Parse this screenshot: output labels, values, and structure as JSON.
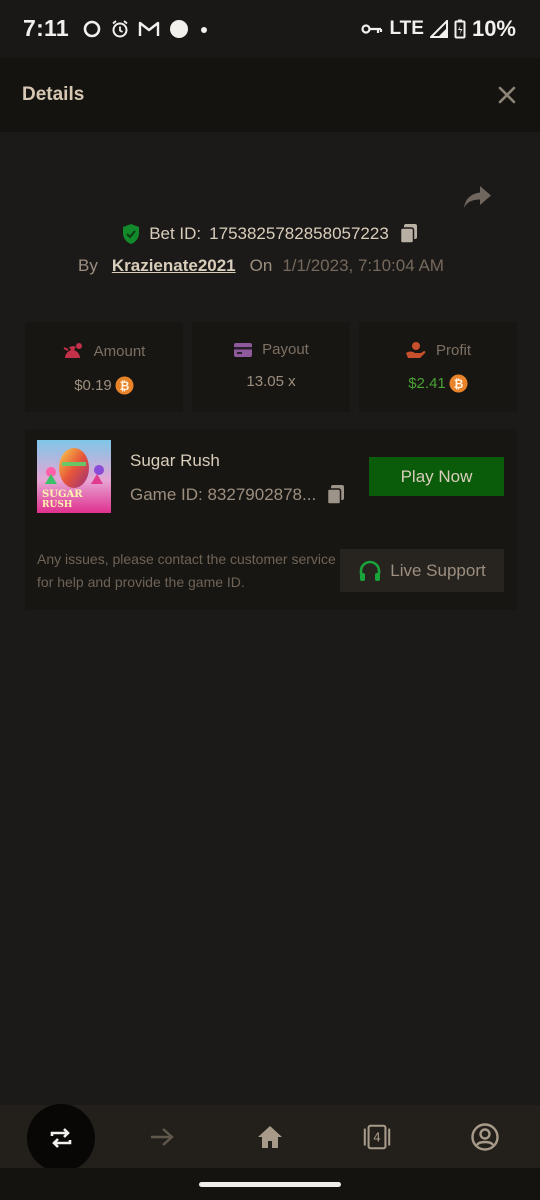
{
  "status_bar": {
    "time": "7:11",
    "network": "LTE",
    "battery": "10%"
  },
  "header": {
    "title": "Details"
  },
  "bet": {
    "id_label": "Bet ID:",
    "id_value": "1753825782858057223",
    "by_label": "By",
    "user": "Krazienate2021",
    "on_label": "On",
    "date": "1/1/2023, 7:10:04 AM"
  },
  "stats": [
    {
      "label": "Amount",
      "value": "$0.19",
      "icon": "money-bag-icon",
      "color": "#c2304a"
    },
    {
      "label": "Payout",
      "value": "13.05 x",
      "icon": "card-icon",
      "color": "#8f5a9b"
    },
    {
      "label": "Profit",
      "value": "$2.41",
      "icon": "hand-coins-icon",
      "color": "#c9502c"
    }
  ],
  "game": {
    "name": "Sugar Rush",
    "thumb_text_1": "SUGAR",
    "thumb_text_2": "RUSH",
    "id_text": "Game ID: 8327902878...",
    "play_label": "Play Now",
    "support_text": "Any issues, please contact the customer service for help and provide the game ID.",
    "support_label": "Live Support"
  },
  "nav": {
    "tabs_count": "4"
  },
  "colors": {
    "background": "#1c1a18",
    "accent_green": "#0a5b0a",
    "profit_green": "#48a234",
    "coin_orange": "#e8832a"
  }
}
